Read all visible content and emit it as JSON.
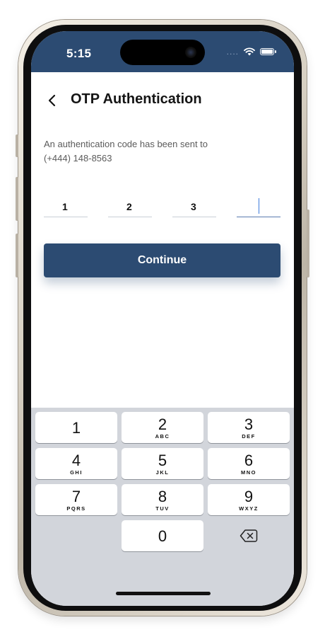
{
  "status_bar": {
    "time": "5:15",
    "signal": "....",
    "background": "#2c4b72"
  },
  "header": {
    "title": "OTP Authentication",
    "back_icon": "chevron-left-icon"
  },
  "message": {
    "line1": "An authentication code has been sent to",
    "line2": "(+444) 148-8563"
  },
  "otp": {
    "digits": [
      "1",
      "2",
      "3",
      ""
    ],
    "active_index": 3
  },
  "continue_label": "Continue",
  "keyboard": {
    "keys": [
      {
        "num": "1",
        "letters": ""
      },
      {
        "num": "2",
        "letters": "ABC"
      },
      {
        "num": "3",
        "letters": "DEF"
      },
      {
        "num": "4",
        "letters": "GHI"
      },
      {
        "num": "5",
        "letters": "JKL"
      },
      {
        "num": "6",
        "letters": "MNO"
      },
      {
        "num": "7",
        "letters": "PQRS"
      },
      {
        "num": "8",
        "letters": "TUV"
      },
      {
        "num": "9",
        "letters": "WXYZ"
      },
      {
        "num": "0",
        "letters": ""
      }
    ],
    "delete_icon": "backspace-icon"
  },
  "colors": {
    "accent": "#2c4b72",
    "keyboard_bg": "#d2d5db"
  }
}
